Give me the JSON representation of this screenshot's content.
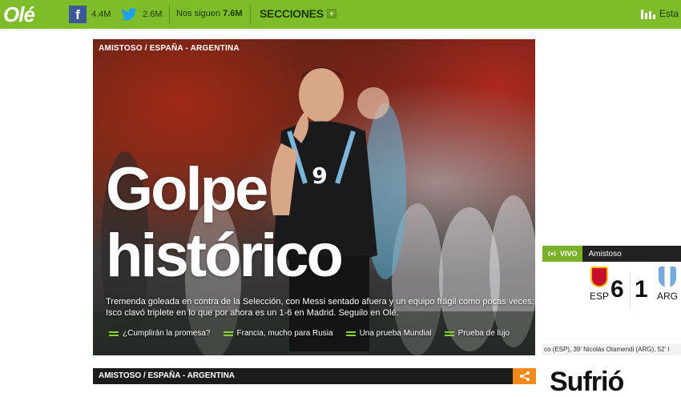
{
  "topbar": {
    "logo": "Olé",
    "facebook_count": "4.4M",
    "twitter_count": "2.6M",
    "follow_label": "Nos siguen",
    "follow_count": "7.6M",
    "sections_label": "SECCIONES",
    "stats_label": "Esta",
    "brand_color": "#7fbc2a"
  },
  "hero": {
    "tag": "AMISTOSO / ESPAÑA - ARGENTINA",
    "headline_line1": "Golpe",
    "headline_line2": "histórico",
    "summary": "Tremenda goleada en contra de la Selección, con Messi sentado afuera y un equipo frágil como pocas veces: Isco clavó triplete en lo que por ahora es un 1-6 en Madrid. Seguilo en Olé.",
    "player_number": "9",
    "related": [
      {
        "label": "¿Cumplirán la promesa?"
      },
      {
        "label": "Francia, mucho para Rusia"
      },
      {
        "label": "Una prueba Mundial"
      },
      {
        "label": "Prueba de lujo"
      }
    ]
  },
  "live": {
    "status": "VIVO",
    "competition": "Amistoso",
    "home_team": "ESP",
    "away_team": "ARG",
    "home_score": "6",
    "away_score": "1",
    "scorers": "co (ESP), 39' Nicolás Otamendi (ARG), 52' I",
    "accent_color": "#79b12a"
  },
  "second": {
    "tag": "AMISTOSO / ESPAÑA - ARGENTINA",
    "title": "Sufrió"
  }
}
